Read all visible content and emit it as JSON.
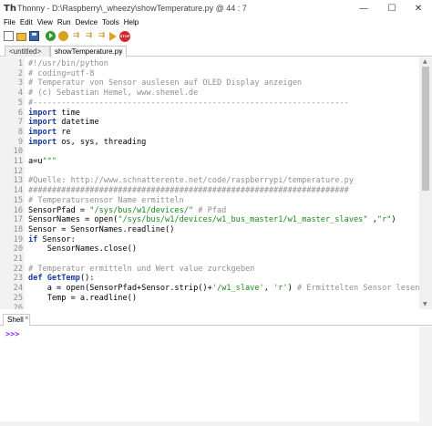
{
  "window": {
    "app_icon_text": "Th",
    "title": "Thonny  -  D:\\Raspberry\\_wheezy\\showTemperature.py  @  44 : 7",
    "minimize_glyph": "—",
    "maximize_glyph": "☐",
    "close_glyph": "✕"
  },
  "menu": [
    "File",
    "Edit",
    "View",
    "Run",
    "Device",
    "Tools",
    "Help"
  ],
  "toolbar": {
    "stop_label": "STOP",
    "step_glyph": "⇉"
  },
  "tabs": [
    {
      "label": "<untitled>"
    },
    {
      "label": "showTemperature.py",
      "close": "×"
    }
  ],
  "editor": {
    "line_numbers": [
      "1",
      "2",
      "3",
      "4",
      "5",
      "6",
      "7",
      "8",
      "9",
      "10",
      "11",
      "12",
      "13",
      "14",
      "15",
      "16",
      "17",
      "18",
      "19",
      "20",
      "21",
      "22",
      "23",
      "24",
      "25",
      "26"
    ],
    "lines": [
      [
        {
          "t": "c",
          "v": "#!/usr/bin/python"
        }
      ],
      [
        {
          "t": "c",
          "v": "# coding=utf-8"
        }
      ],
      [
        {
          "t": "c",
          "v": "# Temperatur von Sensor auslesen auf OLED Display anzeigen"
        }
      ],
      [
        {
          "t": "c",
          "v": "# (c) Sebastian Hemel, www.shemel.de"
        }
      ],
      [
        {
          "t": "c",
          "v": "#-------------------------------------------------------------------"
        }
      ],
      [
        {
          "t": "k",
          "v": "import"
        },
        {
          "t": "n",
          "v": " time"
        }
      ],
      [
        {
          "t": "k",
          "v": "import"
        },
        {
          "t": "n",
          "v": " datetime"
        }
      ],
      [
        {
          "t": "k",
          "v": "import"
        },
        {
          "t": "n",
          "v": " re"
        }
      ],
      [
        {
          "t": "k",
          "v": "import"
        },
        {
          "t": "n",
          "v": " os, sys, threading"
        }
      ],
      [],
      [
        {
          "t": "n",
          "v": "a=u"
        },
        {
          "t": "s",
          "v": "\"°\""
        }
      ],
      [],
      [
        {
          "t": "c",
          "v": "#Quelle: http://www.schnatterente.net/code/raspberrypi/temperature.py"
        }
      ],
      [
        {
          "t": "c",
          "v": "####################################################################"
        }
      ],
      [
        {
          "t": "c",
          "v": "# Temperatursensor Name ermitteln"
        }
      ],
      [
        {
          "t": "n",
          "v": "SensorPfad = "
        },
        {
          "t": "s",
          "v": "\"/sys/bus/w1/devices/\""
        },
        {
          "t": "n",
          "v": " "
        },
        {
          "t": "c",
          "v": "# Pfad"
        }
      ],
      [
        {
          "t": "n",
          "v": "SensorNames = open("
        },
        {
          "t": "s",
          "v": "\"/sys/bus/w1/devices/w1_bus_master1/w1_master_slaves\""
        },
        {
          "t": "n",
          "v": " ,"
        },
        {
          "t": "s",
          "v": "\"r\""
        },
        {
          "t": "n",
          "v": ")"
        }
      ],
      [
        {
          "t": "n",
          "v": "Sensor = SensorNames.readline()"
        }
      ],
      [
        {
          "t": "k",
          "v": "if"
        },
        {
          "t": "n",
          "v": " Sensor:"
        }
      ],
      [
        {
          "t": "n",
          "v": "    SensorNames.close()"
        }
      ],
      [],
      [
        {
          "t": "c",
          "v": "# Temperatur ermitteln und Wert value zurckgeben"
        }
      ],
      [
        {
          "t": "k",
          "v": "def"
        },
        {
          "t": "n",
          "v": " "
        },
        {
          "t": "f",
          "v": "GetTemp"
        },
        {
          "t": "n",
          "v": "():"
        }
      ],
      [
        {
          "t": "n",
          "v": "    a = open(SensorPfad+Sensor.strip()+"
        },
        {
          "t": "s",
          "v": "'/w1_slave'"
        },
        {
          "t": "n",
          "v": ", "
        },
        {
          "t": "s",
          "v": "'r'"
        },
        {
          "t": "n",
          "v": ") "
        },
        {
          "t": "c",
          "v": "# Ermittelten Sensor lesen"
        }
      ],
      [
        {
          "t": "n",
          "v": "    Temp = a.readline()"
        }
      ],
      []
    ]
  },
  "shell": {
    "tab_label": "Shell",
    "tab_close": "×",
    "prompt": ">>>"
  }
}
